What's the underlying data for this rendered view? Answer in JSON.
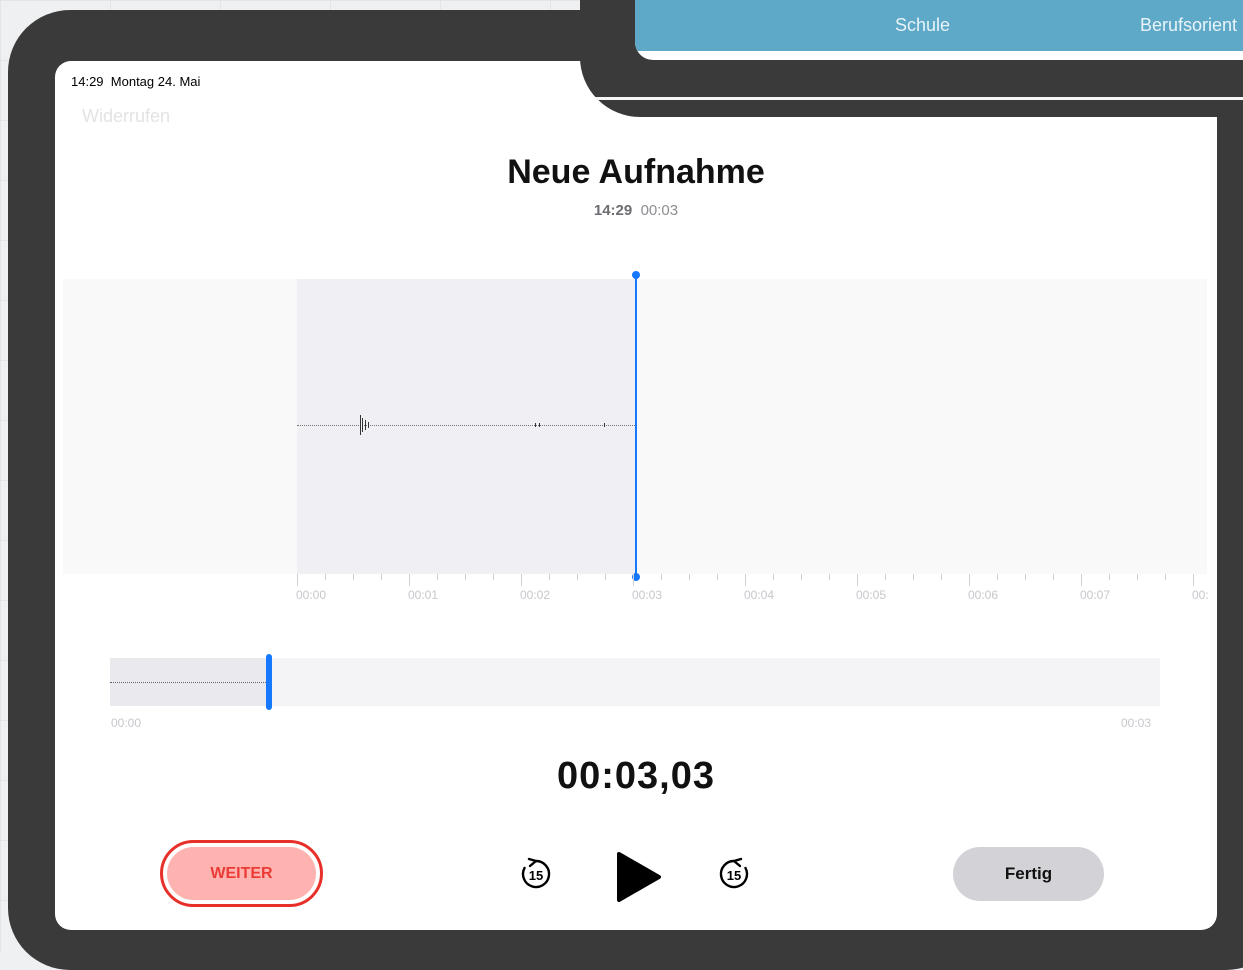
{
  "status_bar": {
    "time": "14:29",
    "date": "Montag 24. Mai"
  },
  "toolbar": {
    "undo_label": "Widerrufen"
  },
  "recording": {
    "title": "Neue Aufnahme",
    "time": "14:29",
    "duration": "00:03"
  },
  "timeline": {
    "labels": [
      "00:00",
      "00:01",
      "00:02",
      "00:03",
      "00:04",
      "00:05",
      "00:06",
      "00:07",
      "00:"
    ]
  },
  "overview": {
    "start": "00:00",
    "end": "00:03"
  },
  "timer": "00:03,03",
  "controls": {
    "weiter_label": "WEITER",
    "skip_back_label": "15",
    "skip_fwd_label": "15",
    "fertig_label": "Fertig"
  },
  "background_app": {
    "tabs": [
      "Schule",
      "Berufsorient"
    ]
  },
  "colors": {
    "accent": "#1677ff",
    "record_red": "#e8302b",
    "weiter_fill": "#ffb3b0",
    "header_blue": "#5ea8c8"
  }
}
